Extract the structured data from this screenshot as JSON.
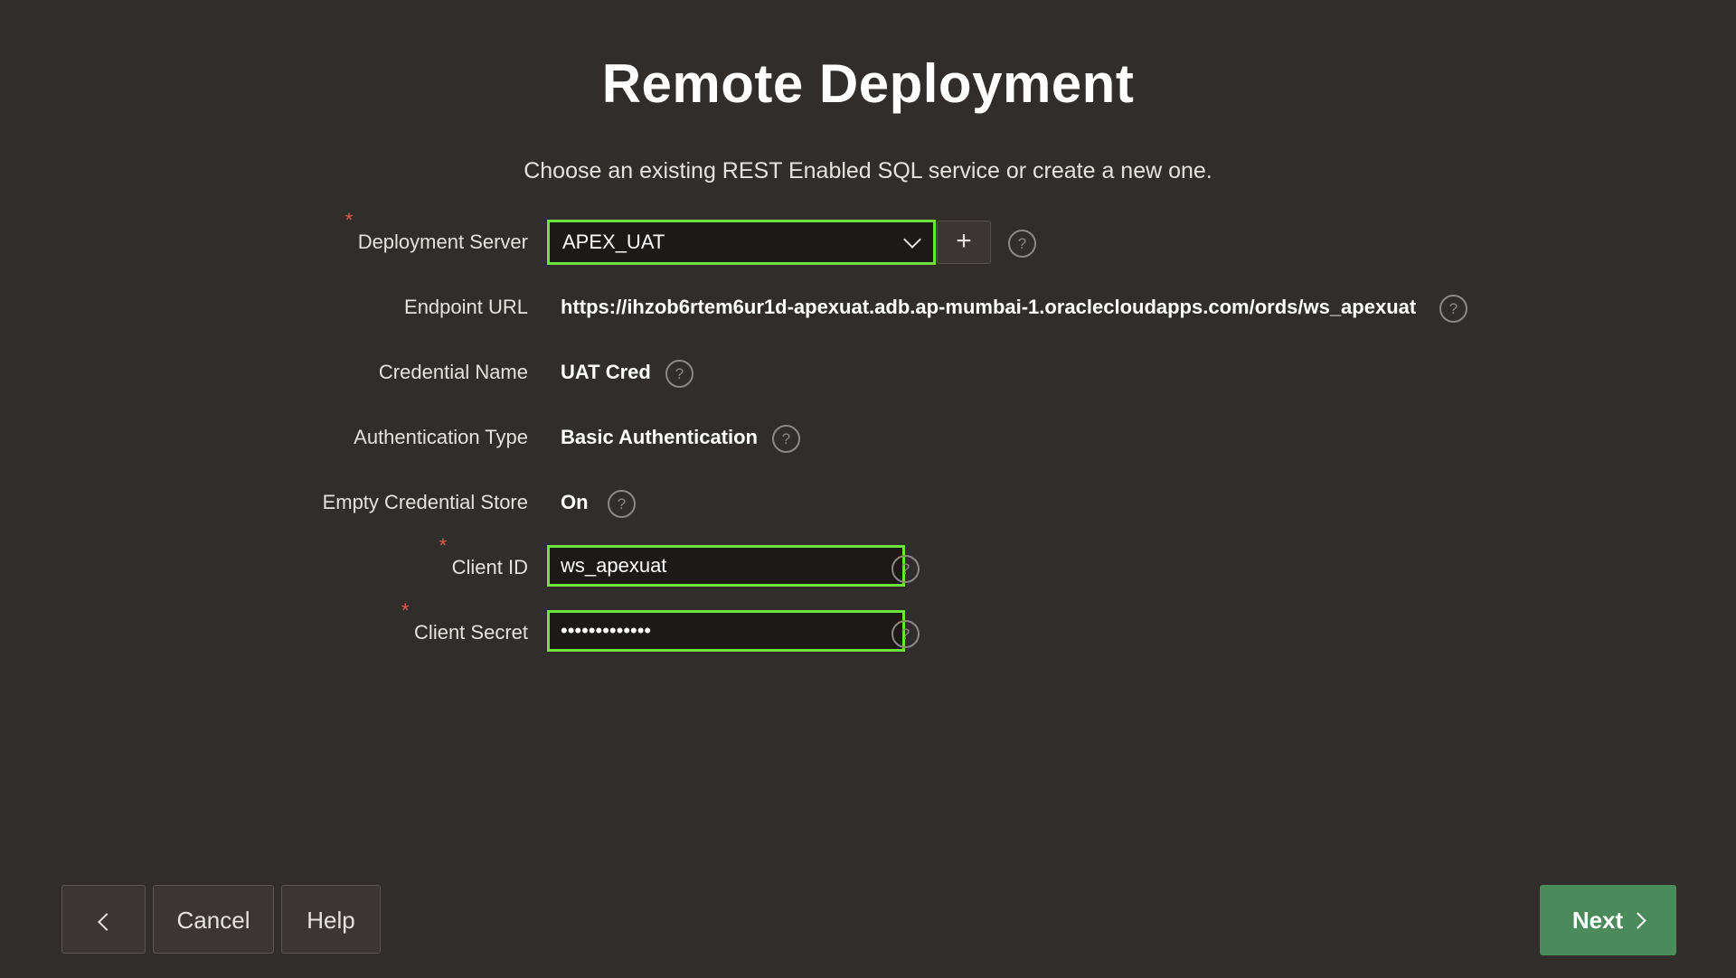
{
  "title": "Remote Deployment",
  "subtitle": "Choose an existing REST Enabled SQL service or create a new one.",
  "form": {
    "deployment_server": {
      "label": "Deployment Server",
      "value": "APEX_UAT",
      "required_marker": "*",
      "add_label": "+",
      "help": "?"
    },
    "endpoint_url": {
      "label": "Endpoint URL",
      "value": "https://ihzob6rtem6ur1d-apexuat.adb.ap-mumbai-1.oraclecloudapps.com/ords/ws_apexuat",
      "help": "?"
    },
    "credential_name": {
      "label": "Credential Name",
      "value": "UAT Cred",
      "help": "?"
    },
    "authentication_type": {
      "label": "Authentication Type",
      "value": "Basic Authentication",
      "help": "?"
    },
    "empty_credential_store": {
      "label": "Empty Credential Store",
      "value": "On",
      "help": "?"
    },
    "client_id": {
      "label": "Client ID",
      "value": "ws_apexuat",
      "required_marker": "*",
      "help": "?"
    },
    "client_secret": {
      "label": "Client Secret",
      "value": "•••••••••••••",
      "required_marker": "*",
      "help": "?"
    }
  },
  "footer": {
    "cancel_label": "Cancel",
    "help_label": "Help",
    "next_label": "Next"
  },
  "colors": {
    "background": "#312d2a",
    "focus_border": "#6fe33d",
    "next_button": "#4b8a5b",
    "required": "#e05a4a"
  },
  "icons": {
    "back": "chevron-left-icon",
    "next": "chevron-right-icon",
    "dropdown": "chevron-down-icon",
    "help": "question-circle-icon",
    "add": "plus-icon"
  }
}
